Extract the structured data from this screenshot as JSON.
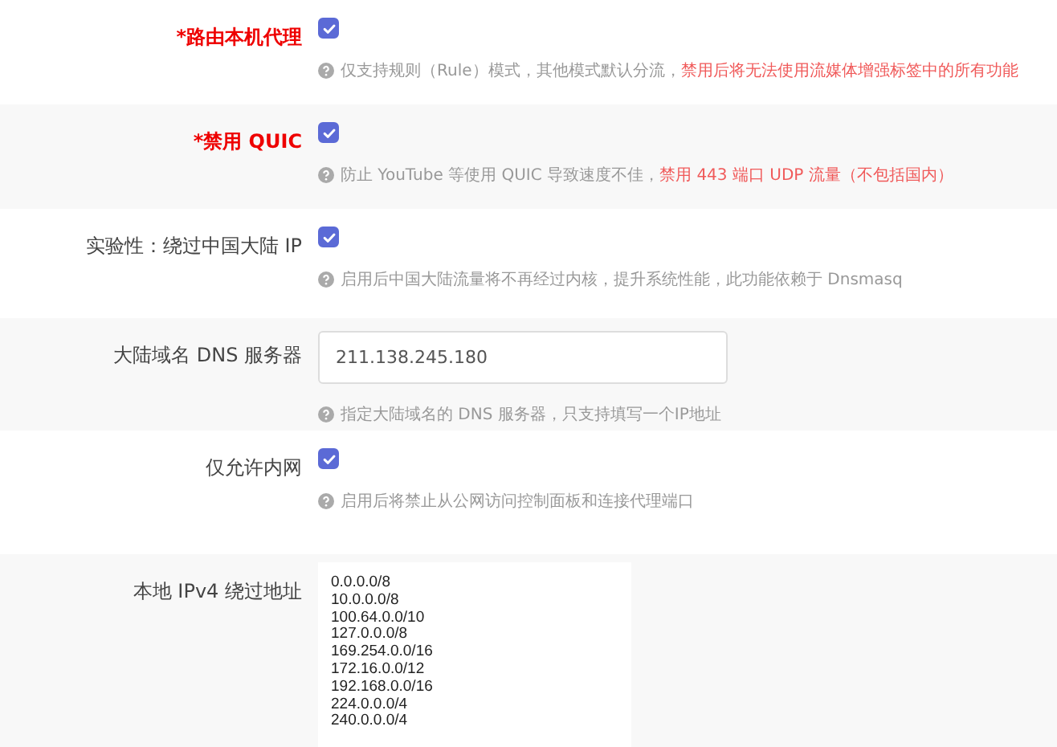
{
  "rows": [
    {
      "kind": "checkbox",
      "label": "*路由本机代理",
      "required": true,
      "checked": true,
      "hint": "仅支持规则（Rule）模式，其他模式默认分流，",
      "warning": "禁用后将无法使用流媒体增强标签中的所有功能"
    },
    {
      "kind": "checkbox",
      "label": "*禁用 QUIC",
      "required": true,
      "checked": true,
      "hint": "防止 YouTube 等使用 QUIC 导致速度不佳，",
      "warning": "禁用 443 端口 UDP 流量（不包括国内）"
    },
    {
      "kind": "checkbox",
      "label": "实验性：绕过中国大陆 IP",
      "required": false,
      "checked": true,
      "hint": "启用后中国大陆流量将不再经过内核，提升系统性能，此功能依赖于 Dnsmasq"
    },
    {
      "kind": "input",
      "label": "大陆域名 DNS 服务器",
      "required": false,
      "value": "211.138.245.180",
      "hint": "指定大陆域名的 DNS 服务器，只支持填写一个IP地址"
    },
    {
      "kind": "checkbox",
      "label": "仅允许内网",
      "required": false,
      "checked": true,
      "hint": "启用后将禁止从公网访问控制面板和连接代理端口"
    },
    {
      "kind": "textarea",
      "label": "本地 IPv4 绕过地址",
      "required": false,
      "lines": [
        "0.0.0.0/8",
        "10.0.0.0/8",
        "100.64.0.0/10",
        "127.0.0.0/8",
        "169.254.0.0/16",
        "172.16.0.0/12",
        "192.168.0.0/16",
        "224.0.0.0/4",
        "240.0.0.0/4"
      ]
    }
  ]
}
